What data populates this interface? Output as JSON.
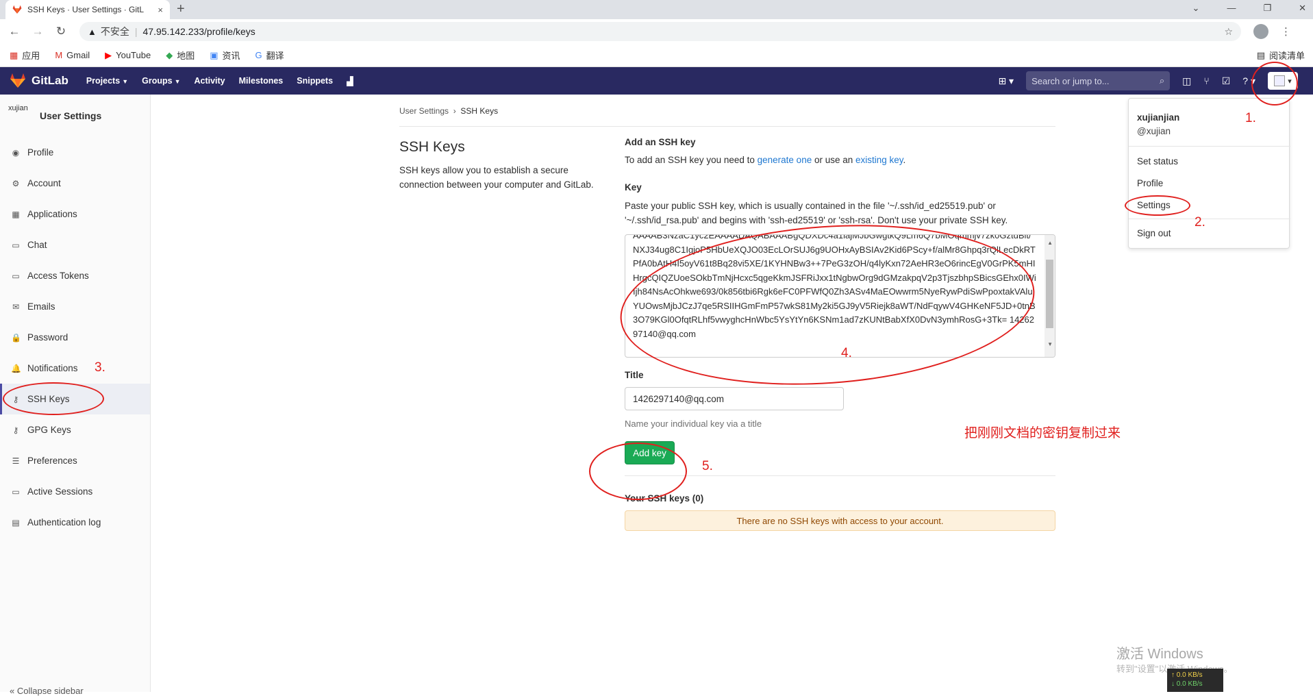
{
  "browser": {
    "tab_title": "SSH Keys · User Settings · GitL",
    "tab_close": "×",
    "new_tab": "+",
    "insecure_label": "不安全",
    "url": "47.95.142.233/profile/keys",
    "bookmarks": [
      {
        "icon": "apps-grid-icon",
        "glyph": "▦",
        "label": "应用",
        "color": "#d93025"
      },
      {
        "icon": "gmail-icon",
        "glyph": "M",
        "label": "Gmail",
        "color": "#d93025"
      },
      {
        "icon": "youtube-icon",
        "glyph": "▶",
        "label": "YouTube",
        "color": "#ff0000"
      },
      {
        "icon": "map-icon",
        "glyph": "◆",
        "label": "地图",
        "color": "#34a853"
      },
      {
        "icon": "news-icon",
        "glyph": "▣",
        "label": "资讯",
        "color": "#4285f4"
      },
      {
        "icon": "translate-icon",
        "glyph": "G",
        "label": "翻译",
        "color": "#4285f4"
      }
    ],
    "reading_list": "阅读清单"
  },
  "header": {
    "brand": "GitLab",
    "nav": [
      "Projects",
      "Groups",
      "Activity",
      "Milestones",
      "Snippets"
    ],
    "search_placeholder": "Search or jump to..."
  },
  "sidebar": {
    "title": "User Settings",
    "avatar_alt": "xujian",
    "items": [
      {
        "label": "Profile",
        "icon": "profile-icon",
        "glyph": "◉"
      },
      {
        "label": "Account",
        "icon": "account-icon",
        "glyph": "⚙"
      },
      {
        "label": "Applications",
        "icon": "applications-icon",
        "glyph": "▦"
      },
      {
        "label": "Chat",
        "icon": "chat-icon",
        "glyph": "▭"
      },
      {
        "label": "Access Tokens",
        "icon": "token-icon",
        "glyph": "▭"
      },
      {
        "label": "Emails",
        "icon": "email-icon",
        "glyph": "✉"
      },
      {
        "label": "Password",
        "icon": "lock-icon",
        "glyph": "🔒"
      },
      {
        "label": "Notifications",
        "icon": "bell-icon",
        "glyph": "🔔"
      },
      {
        "label": "SSH Keys",
        "icon": "key-icon",
        "glyph": "⚷",
        "active": true
      },
      {
        "label": "GPG Keys",
        "icon": "key-icon",
        "glyph": "⚷"
      },
      {
        "label": "Preferences",
        "icon": "sliders-icon",
        "glyph": "☰"
      },
      {
        "label": "Active Sessions",
        "icon": "monitor-icon",
        "glyph": "▭"
      },
      {
        "label": "Authentication log",
        "icon": "log-icon",
        "glyph": "▤"
      }
    ],
    "collapse_label": "Collapse sidebar"
  },
  "breadcrumb": {
    "parent": "User Settings",
    "current": "SSH Keys"
  },
  "page": {
    "title": "SSH Keys",
    "description": "SSH keys allow you to establish a secure connection between your computer and GitLab."
  },
  "form": {
    "add_heading": "Add an SSH key",
    "intro_pre": "To add an SSH key you need to ",
    "intro_link1": "generate one",
    "intro_mid": " or use an ",
    "intro_link2": "existing key",
    "intro_post": ".",
    "key_label": "Key",
    "key_hint": "Paste your public SSH key, which is usually contained in the file '~/.ssh/id_ed25519.pub' or '~/.ssh/id_rsa.pub' and begins with 'ssh-ed25519' or 'ssh-rsa'. Don't use your private SSH key.",
    "key_value": "AAAAB3NzaC1yc2EAAAADAQABAAABgQDXDc4a1iajMJbGwgtkQ9Lm6Q7bMOqmmjv7zk0GztdBlt/NXJ34ug8C1IgjoP5HbUeXQJO03EcLOrSUJ6g9UOHxAyBSIAv2Kid6PScy+f/alMr8Ghpq3rQlLecDkRTPfA0bAtH4I5oyV61t8Bq28vi5XE/1KYHNBw3++7PeG3zOH/q4lyKxn72AeHR3eO6rincEgV0GrPK5mHIHrgcQIQZUoeSOkbTmNjHcxc5qgeKkmJSFRiJxx1tNgbwOrg9dGMzakpqV2p3TjszbhpSBicsGEhx0IWiIjh84NsAcOhkwe693/0k856tbi6Rgk6eFC0PFWfQ0Zh3ASv4MaEOwwrm5NyeRywPdiSwPpoxtakVAluYUOwsMjbJCzJ7qe5RSIIHGmFmP57wkS81My2ki5GJ9yV5Riejk8aWT/NdFqywV4GHKeNF5JD+0tnB3O79KGl0OfqtRLhf5vwyghcHnWbc5YsYtYn6KSNm1ad7zKUNtBabXfX0DvN3ymhRosG+3Tk= 1426297140@qq.com",
    "title_label": "Title",
    "title_value": "1426297140@qq.com",
    "title_hint": "Name your individual key via a title",
    "add_button": "Add key",
    "your_keys": "Your SSH keys (0)",
    "no_keys": "There are no SSH keys with access to your account."
  },
  "dropdown": {
    "name": "xujianjian",
    "handle": "@xujian",
    "items": [
      "Set status",
      "Profile",
      "Settings",
      "Sign out"
    ]
  },
  "annotations": {
    "n1": "1.",
    "n2": "2.",
    "n3": "3.",
    "n4": "4.",
    "n5": "5.",
    "note": "把刚刚文档的密钥复制过来",
    "color": "#e0201e"
  },
  "system": {
    "watermark": "激活 Windows",
    "watermark_sub": "转到\"设置\"以激活 Windows。",
    "net_up": "↑ 0.0 KB/s",
    "net_down": "↓ 0.0 KB/s"
  },
  "colors": {
    "header_bg": "#292961",
    "accent_green": "#1aaa55",
    "link": "#1f78d1",
    "warning_bg": "#fdf1dd"
  }
}
